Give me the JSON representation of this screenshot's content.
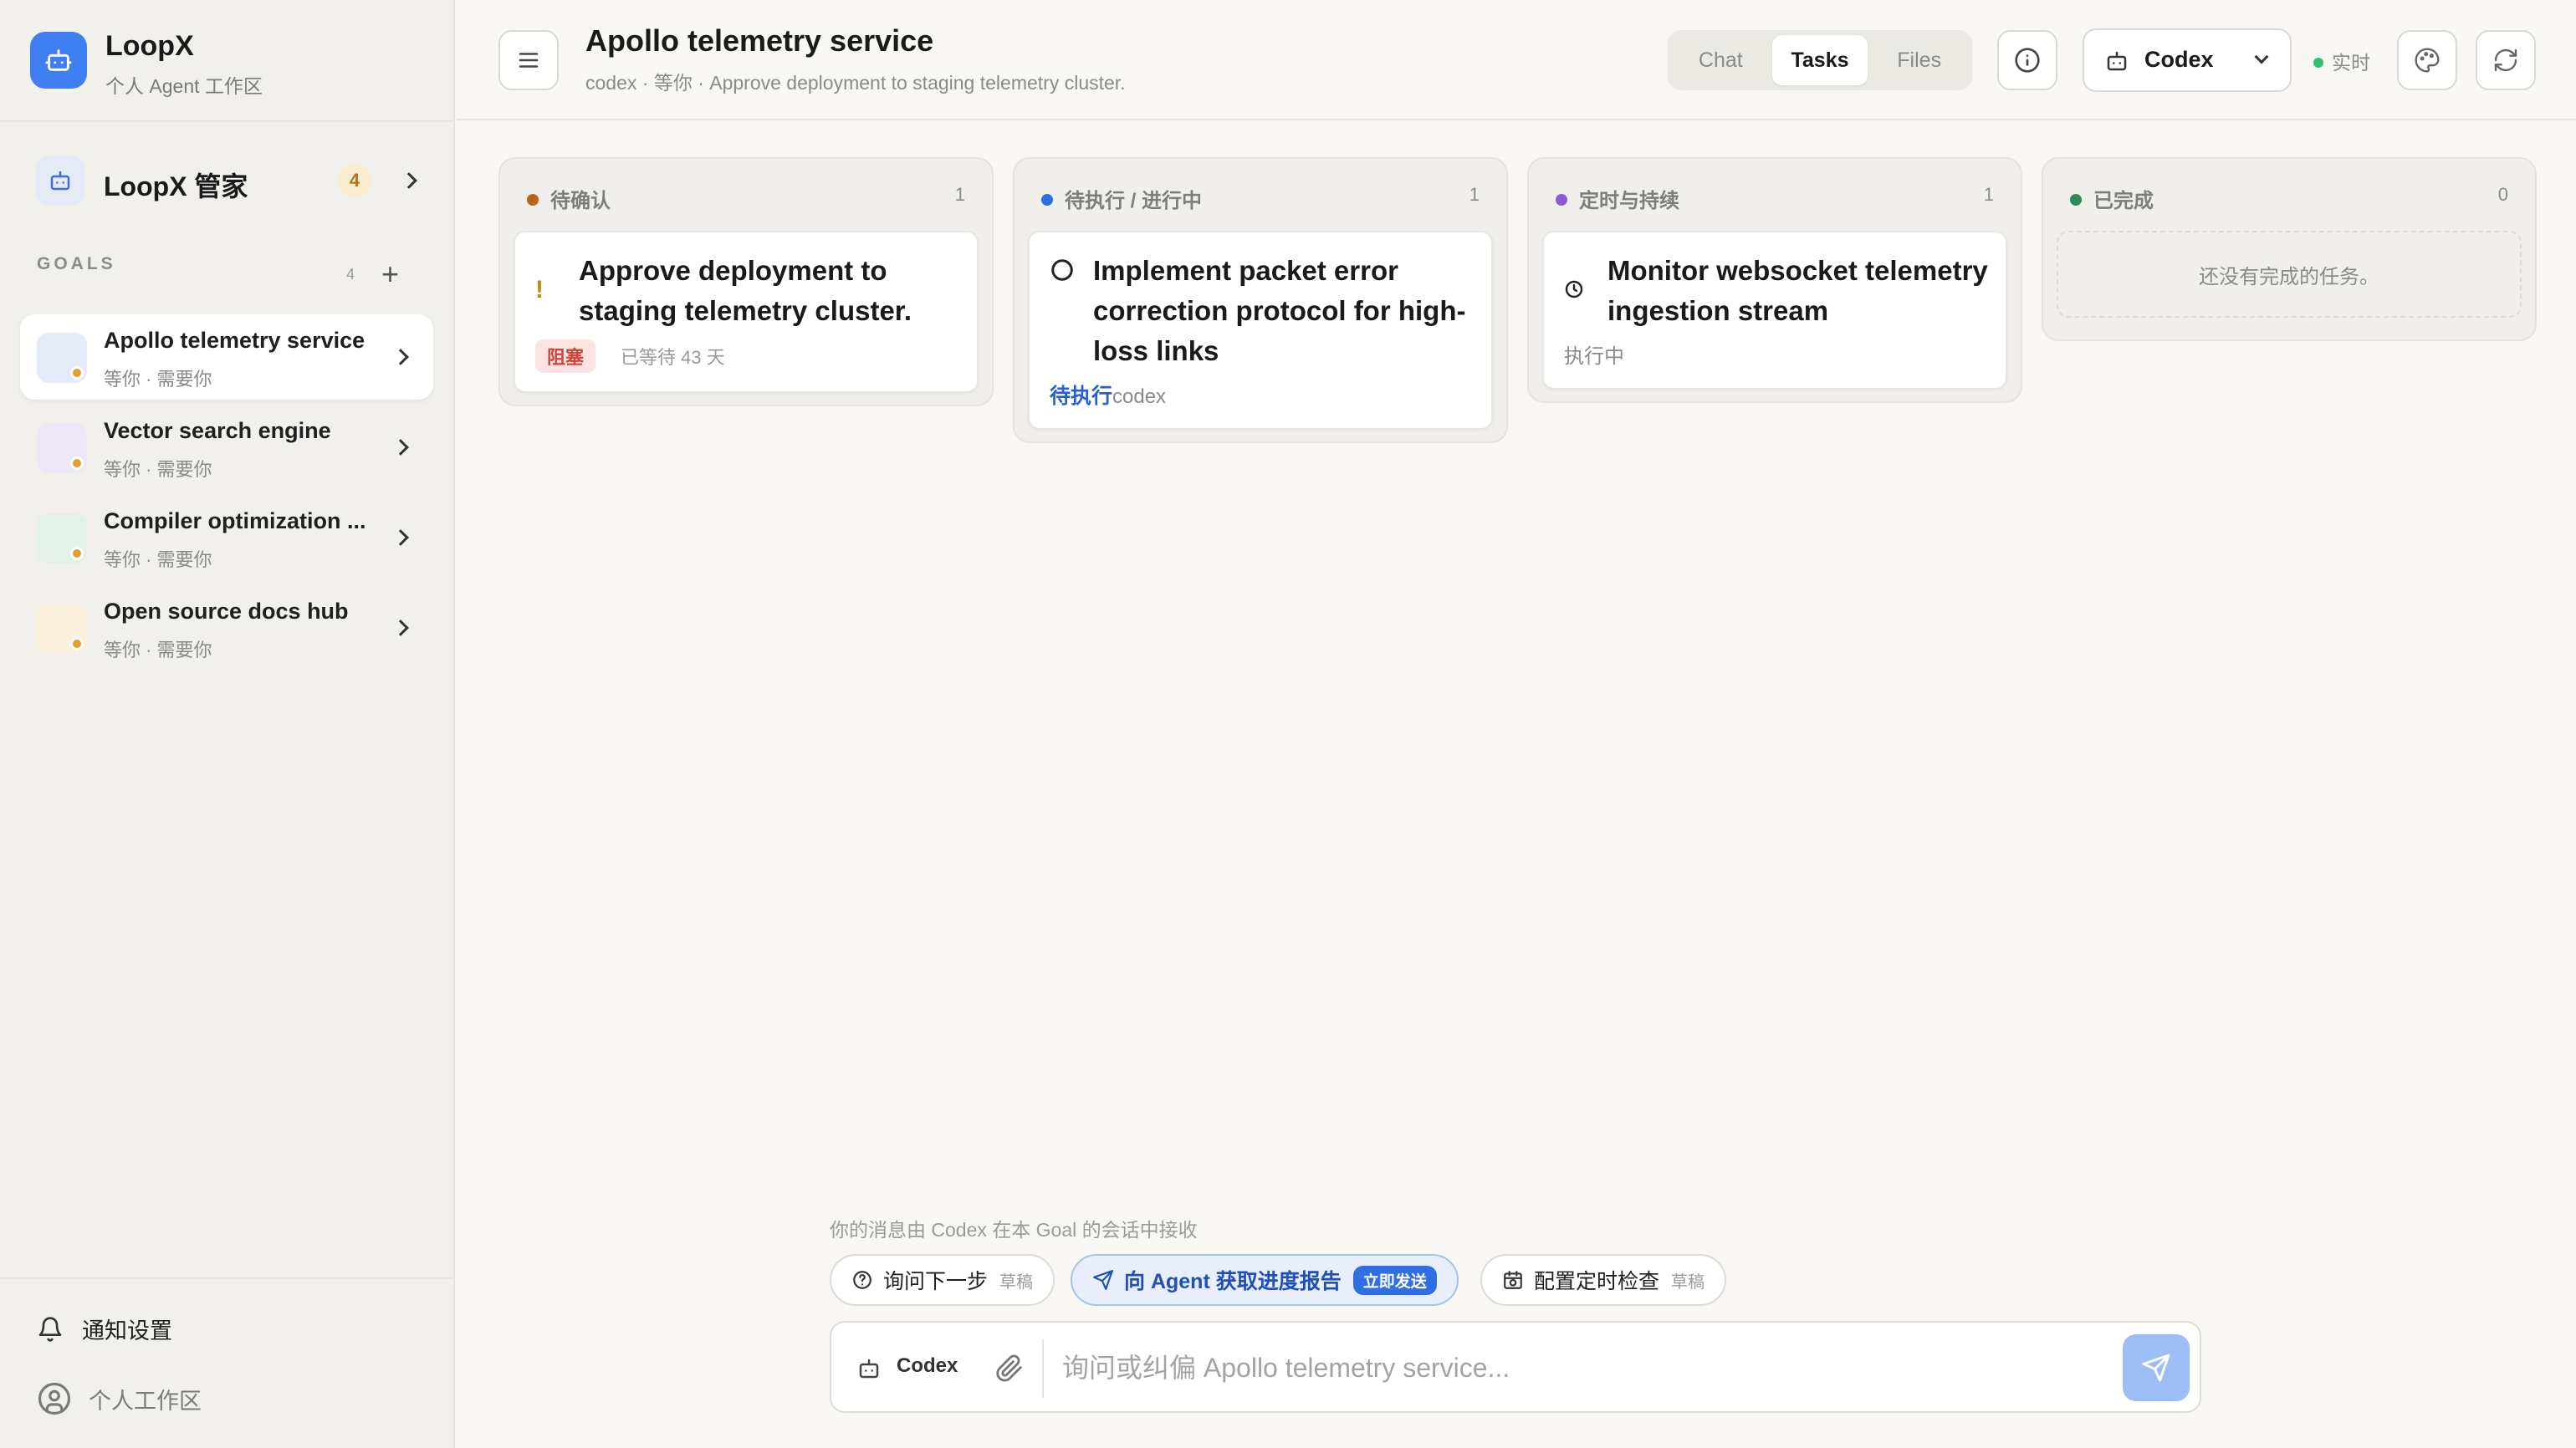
{
  "brand": {
    "name": "LoopX",
    "subtitle": "个人 Agent 工作区"
  },
  "steward": {
    "label": "LoopX 管家",
    "badge": "4"
  },
  "goals": {
    "section_label": "GOALS",
    "count": "4",
    "add_label": "+",
    "items": [
      {
        "title": "Apollo telemetry service",
        "subtitle": "等你 · 需要你",
        "active": true,
        "avatar_color": "#e4eaf8"
      },
      {
        "title": "Vector search engine",
        "subtitle": "等你 · 需要你",
        "active": false,
        "avatar_color": "#ece8f8"
      },
      {
        "title": "Compiler optimization ...",
        "subtitle": "等你 · 需要你",
        "active": false,
        "avatar_color": "#e3f2e8"
      },
      {
        "title": "Open source docs hub",
        "subtitle": "等你 · 需要你",
        "active": false,
        "avatar_color": "#fbf0dc"
      }
    ]
  },
  "sidebar_footer": {
    "notifications": "通知设置",
    "workspace": "个人工作区"
  },
  "header": {
    "title": "Apollo telemetry service",
    "subtitle": "codex · 等你 · Approve deployment to staging telemetry cluster.",
    "tabs": [
      {
        "label": "Chat",
        "active": false
      },
      {
        "label": "Tasks",
        "active": true
      },
      {
        "label": "Files",
        "active": false
      }
    ],
    "agent": "Codex",
    "live_label": "实时"
  },
  "board": {
    "columns": [
      {
        "title": "待确认",
        "count": "1",
        "dot_color": "#b8651a",
        "card": {
          "title": "Approve deployment to staging telemetry cluster.",
          "tag": "阻塞",
          "meta": "已等待 43 天",
          "icon": "exclamation-icon"
        }
      },
      {
        "title": "待执行 / 进行中",
        "count": "1",
        "dot_color": "#2f6ee3",
        "card": {
          "title": "Implement packet error correction protocol for high-loss links",
          "status": "待执行",
          "agent": "codex",
          "icon": "circle-icon"
        }
      },
      {
        "title": "定时与持续",
        "count": "1",
        "dot_color": "#8a5ad8",
        "card": {
          "title": "Monitor websocket telemetry ingestion stream",
          "status": "执行中",
          "icon": "clock-icon"
        }
      },
      {
        "title": "已完成",
        "count": "0",
        "dot_color": "#2e8a5a",
        "empty_text": "还没有完成的任务。"
      }
    ]
  },
  "composer": {
    "hint": "你的消息由 Codex 在本 Goal 的会话中接收",
    "chips": [
      {
        "label": "询问下一步",
        "suffix": "草稿"
      },
      {
        "label": "向 Agent 获取进度报告",
        "suffix": "立即发送"
      },
      {
        "label": "配置定时检查",
        "suffix": "草稿"
      }
    ],
    "agent": "Codex",
    "placeholder": "询问或纠偏 Apollo telemetry service..."
  },
  "colors": {
    "accent": "#2f6ee3",
    "brand": "#3f7ef0",
    "warning": "#e0a030",
    "danger": "#d0443a",
    "live": "#34c070"
  }
}
